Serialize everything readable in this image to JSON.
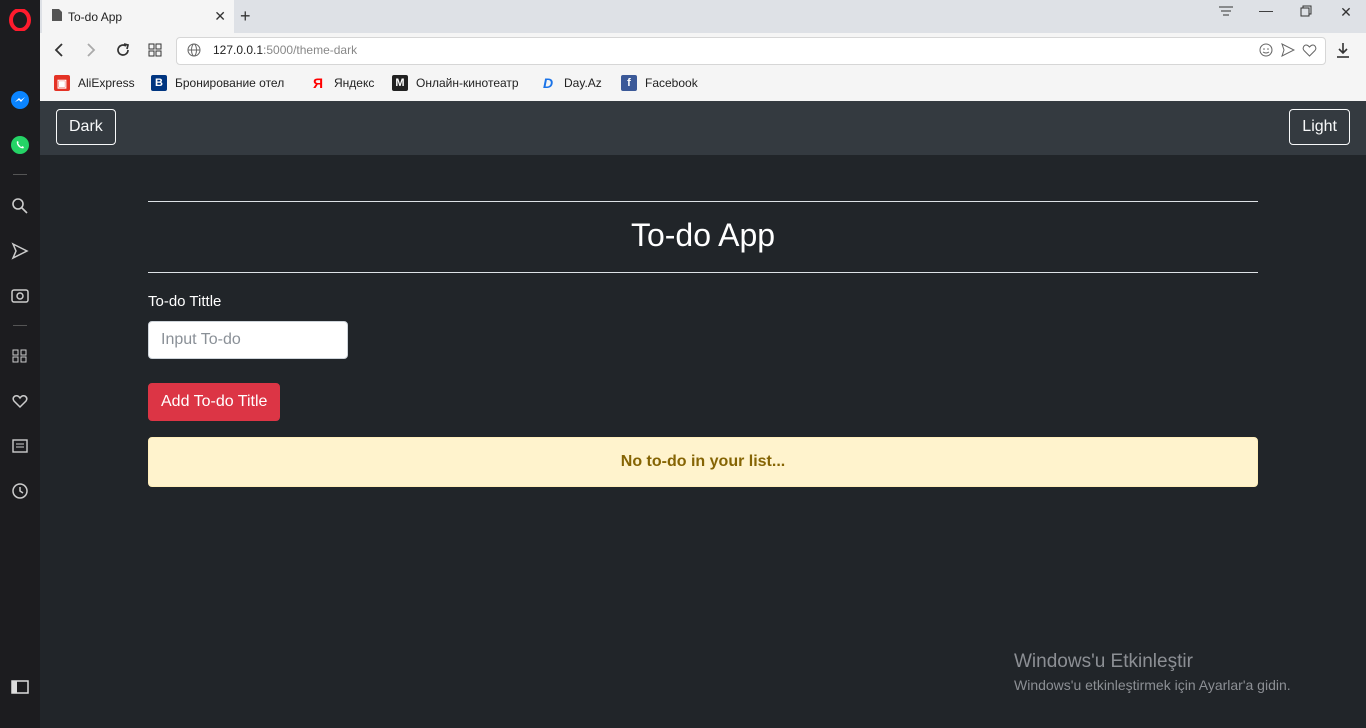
{
  "browser": {
    "tab_title": "To-do App",
    "new_tab_label": "+",
    "url_host": "127.0.0.1",
    "url_path": ":5000/theme-dark",
    "bookmarks": [
      {
        "label": "AliExpress",
        "color": "#e43225"
      },
      {
        "label": "Бронирование отел",
        "color": "#003580"
      },
      {
        "label": "Яндекс",
        "color": "#ff0000"
      },
      {
        "label": "Онлайн-кинотеатр",
        "color": "#222222"
      },
      {
        "label": "Day.Az",
        "color": "#1a73e8"
      },
      {
        "label": "Facebook",
        "color": "#3b5998"
      }
    ]
  },
  "navbar": {
    "dark_label": "Dark",
    "light_label": "Light"
  },
  "main": {
    "title": "To-do App",
    "field_label": "To-do Tittle",
    "input_placeholder": "Input To-do",
    "input_value": "",
    "add_button": "Add To-do Title",
    "empty_message": "No to-do in your list..."
  },
  "watermark": {
    "title": "Windows'u Etkinleştir",
    "subtitle": "Windows'u etkinleştirmek için Ayarlar'a gidin."
  },
  "colors": {
    "page_bg": "#212529",
    "navbar_bg": "#343a40",
    "danger": "#dc3545",
    "warning_bg": "#fff3cd",
    "warning_text": "#856404"
  }
}
